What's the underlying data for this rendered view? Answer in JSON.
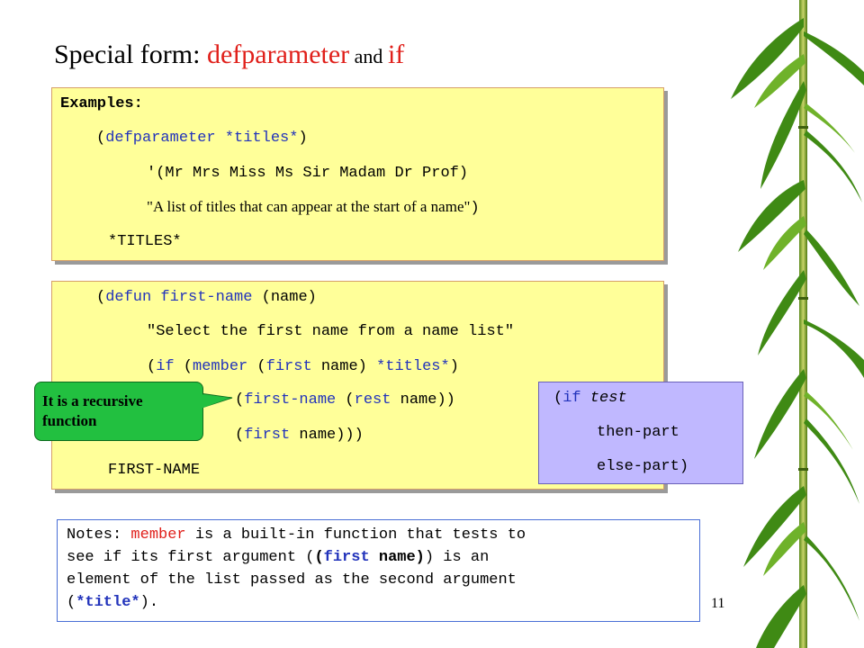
{
  "title": {
    "prefix": "Special form: ",
    "kw1": "defparameter",
    "and": " and ",
    "kw2": "if"
  },
  "example_box": {
    "label": "Examples:",
    "line1_open": "(",
    "line1_kw": "defparameter",
    "line1_var": " *titles*",
    "line1_close": ")",
    "line2": "'(Mr Mrs Miss Ms Sir Madam Dr Prof)",
    "line3_text": "\"A list of titles that can appear at the start of a name\"",
    "line3_close": ")",
    "line4": "*TITLES*"
  },
  "defun_box": {
    "l1_open": "(",
    "l1_kw": "defun",
    "l1_fn": " first-name ",
    "l1_arg": "(name)",
    "l2": "\"Select the first name from a name list\"",
    "l3_open": "(",
    "l3_if": "if",
    "l3_p1": " (",
    "l3_member": "member",
    "l3_p2": " (",
    "l3_first": "first",
    "l3_p3": " name) ",
    "l3_titles": "*titles*",
    "l3_p4": ")",
    "l4_open": "(",
    "l4_fn": "first-name",
    "l4_p1": " (",
    "l4_rest": "rest",
    "l4_p2": " name))",
    "l5_open": "(",
    "l5_first": "first",
    "l5_p": " name)))",
    "l6": "FIRST-NAME"
  },
  "callout": {
    "text": "It is a recursive function"
  },
  "if_box": {
    "open": "(",
    "kw": "if",
    "test": " test",
    "then": "then-part",
    "else": "else-part)"
  },
  "notes": {
    "l1_a": "Notes: ",
    "l1_member": "member",
    "l1_b": " is a built-in function that tests to",
    "l2": "see if its first argument (",
    "l2_bold_a": "(",
    "l2_first": "first",
    "l2_bold_b": " name)",
    "l2_c": ") is an",
    "l3": "element of the list passed as the second argument",
    "l4_a": "(",
    "l4_bold": "*title*",
    "l4_b": ")."
  },
  "page_number": "11",
  "colors": {
    "keyword": "#2233bb",
    "title_red": "#e0201b",
    "box_yellow": "#ffff99",
    "callout_green": "#22c040",
    "ifbox_purple": "#c0b8ff"
  }
}
